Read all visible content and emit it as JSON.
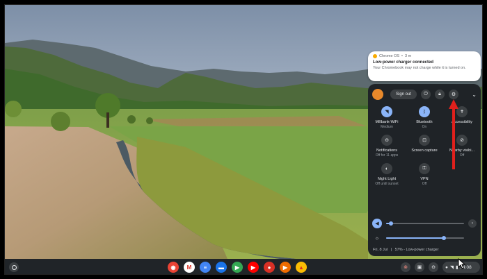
{
  "notification": {
    "source": "Chrome OS",
    "time": "3 m",
    "title": "Low-power charger connected",
    "body": "Your Chromebook may not charge while it is turned on."
  },
  "quick_settings": {
    "signout_label": "Sign out",
    "top_icons": [
      "power-icon",
      "lock-icon",
      "gear-icon",
      "chevron-down-icon"
    ],
    "tiles": [
      {
        "label": "Millbank-WiFi",
        "sub": "Medium",
        "icon": "wifi-icon",
        "on": true,
        "glyph": "◥"
      },
      {
        "label": "Bluetooth",
        "sub": "On",
        "icon": "bluetooth-icon",
        "on": true,
        "glyph": "ᛒ"
      },
      {
        "label": "Accessibility",
        "sub": "",
        "icon": "accessibility-icon",
        "on": false,
        "glyph": "✝"
      },
      {
        "label": "Notifications",
        "sub": "Off for 11 apps",
        "icon": "notifications-icon",
        "on": false,
        "glyph": "⊖"
      },
      {
        "label": "Screen capture",
        "sub": "",
        "icon": "screen-capture-icon",
        "on": false,
        "glyph": "⊡"
      },
      {
        "label": "Nearby visibi...",
        "sub": "Off",
        "icon": "nearby-share-icon",
        "on": false,
        "glyph": "⊘"
      },
      {
        "label": "Night Light",
        "sub": "Off until sunset",
        "icon": "night-light-icon",
        "on": false,
        "glyph": "◐"
      },
      {
        "label": "VPN",
        "sub": "Off",
        "icon": "vpn-icon",
        "on": false,
        "glyph": "⚿"
      }
    ],
    "volume_level": 0.06,
    "brightness_level": 0.74,
    "footer_date": "Fri, 8 Jul",
    "footer_battery": "57% - Low-power charger"
  },
  "shelf": {
    "apps": [
      {
        "name": "chrome-app-icon",
        "color": "#ea4335",
        "glyph": "◉"
      },
      {
        "name": "gmail-app-icon",
        "color": "#ffffff",
        "glyph": "M"
      },
      {
        "name": "docs-app-icon",
        "color": "#4285f4",
        "glyph": "≡"
      },
      {
        "name": "files-app-icon",
        "color": "#1a73e8",
        "glyph": "▬"
      },
      {
        "name": "play-store-app-icon",
        "color": "#34a853",
        "glyph": "▶"
      },
      {
        "name": "youtube-app-icon",
        "color": "#ff0000",
        "glyph": "▶"
      },
      {
        "name": "record-app-icon",
        "color": "#d93025",
        "glyph": "●"
      },
      {
        "name": "play-movies-app-icon",
        "color": "#ef6c00",
        "glyph": "▶"
      },
      {
        "name": "drive-app-icon",
        "color": "#fbbc04",
        "glyph": "▲"
      }
    ],
    "time": "14:08"
  },
  "colors": {
    "accent": "#8ab4f8",
    "annotation_arrow": "#e0201c"
  }
}
